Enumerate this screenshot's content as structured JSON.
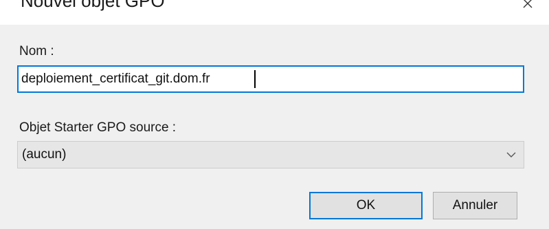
{
  "dialog": {
    "title": "Nouvel objet GPO",
    "close_icon": "close-icon"
  },
  "form": {
    "name_label": "Nom :",
    "name_value": "deploiement_certificat_git.dom.fr",
    "starter_label": "Objet Starter GPO source :",
    "starter_selected": "(aucun)"
  },
  "buttons": {
    "ok_label": "OK",
    "cancel_label": "Annuler"
  },
  "colors": {
    "accent": "#0078d7",
    "dialog_bg": "#f0f0f0",
    "select_bg": "#e6e6e6",
    "button_bg": "#e1e1e1"
  }
}
